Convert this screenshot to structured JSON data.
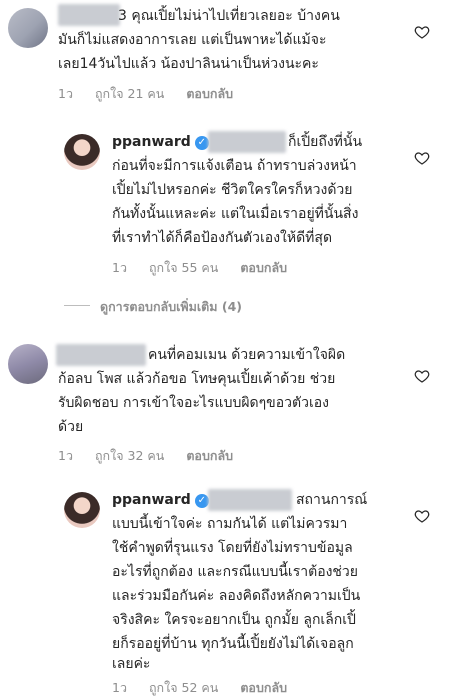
{
  "comments": [
    {
      "lines": [
        "3 คุณเปิ้ยไม่น่าไปเที่ยวเลยอะ บ้างคน",
        "มันก็ไม่แสดงอาการเลย แต่เป็นพาหะได้แม้จะ",
        "เลย14วันไปแล้ว น้องปาลินน่าเป็นห่วงนะคะ"
      ],
      "time": "1ว",
      "likes": "ถูกใจ 21 คน",
      "reply": "ตอบกลับ"
    },
    {
      "username": "ppanward",
      "lines": [
        "ก็เปิ้ยถึงที่นั้น",
        "ก่อนที่จะมีการแจ้งเตือน ถ้าทราบล่วงหน้า",
        "เปิ้ยไม่ไปหรอกค่ะ ชีวิตใครใครก็หวงด้วย",
        "กันทั้งนั้นแหละค่ะ แต่ในเมื่อเราอยู่ที่นั้นสิ่ง",
        "ที่เราทำได้ก็คือป้องกันตัวเองให้ดีที่สุด"
      ],
      "time": "1ว",
      "likes": "ถูกใจ 55 คน",
      "reply": "ตอบกลับ"
    },
    {
      "lines": [
        "คนที่คอมเมน ด้วยความเข้าใจผิด",
        "ก้อลบ โพส แล้วก้อขอ โทษคุนเปิ้ยเค้าด้วย ช่วย",
        "รับผิดชอบ การเข้าใจอะไรแบบผิดๆขอวตัวเอง",
        "ด้วย"
      ],
      "time": "1ว",
      "likes": "ถูกใจ 32 คน",
      "reply": "ตอบกลับ"
    },
    {
      "username": "ppanward",
      "lines": [
        "สถานการณ์",
        "แบบนี้เข้าใจค่ะ ถามกันได้ แต่ไม่ควรมา",
        "ใช้คำพูดที่รุนแรง โดยที่ยังไม่ทราบข้อมูล",
        "อะไรที่ถูกต้อง และกรณีแบบนี้เราต้องช่วย",
        "และร่วมมือกันค่ะ ลองคิดถึงหลักความเป็น",
        "จริงสิคะ ใครจะอยากเป็น ถูกมั้ย ลูกเล็กเปิ้",
        "ยก็รออยู่ที่บ้าน ทุกวันนี้เปิ้ยยังไม่ได้เจอลูก",
        "เลยค่ะ"
      ],
      "time": "1ว",
      "likes": "ถูกใจ 52 คน",
      "reply": "ตอบกลับ"
    }
  ],
  "view_more_replies": "ดูการตอบกลับเพิ่มเติม (4)",
  "colors": {
    "verified": "#3897f0",
    "meta": "#8e8e8e",
    "text": "#262626"
  }
}
